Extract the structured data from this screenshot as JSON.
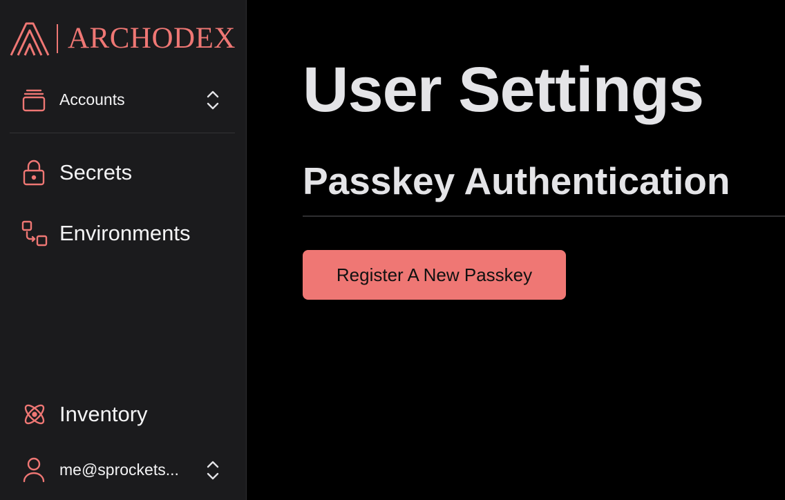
{
  "brand": {
    "name": "ARCHODEX",
    "accent": "#ef7774"
  },
  "sidebar": {
    "account_switcher": {
      "label": "Accounts",
      "icon": "stack-icon"
    },
    "items": [
      {
        "label": "Secrets",
        "icon": "lock-icon"
      },
      {
        "label": "Environments",
        "icon": "environments-icon"
      }
    ],
    "inventory": {
      "label": "Inventory",
      "icon": "atom-icon"
    },
    "user": {
      "label": "me@sprockets...",
      "icon": "user-icon"
    }
  },
  "main": {
    "title": "User Settings",
    "section_title": "Passkey Authentication",
    "register_button": "Register A New Passkey"
  },
  "colors": {
    "sidebar_bg": "#1b1b1d",
    "main_bg": "#000000",
    "heading": "#e4e4e7",
    "button_bg": "#ef7774"
  }
}
